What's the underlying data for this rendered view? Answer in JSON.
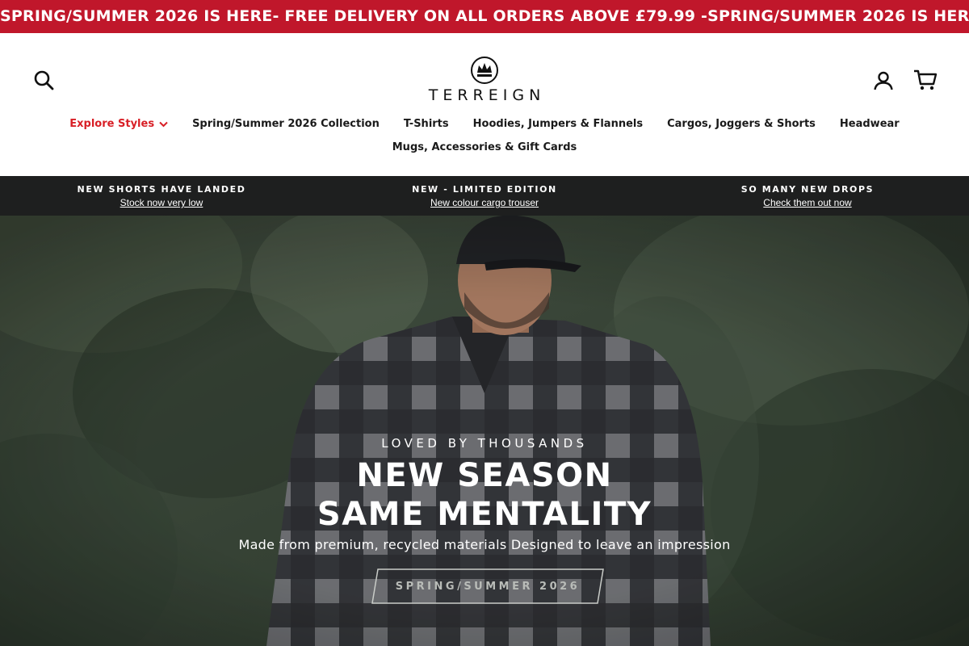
{
  "announcement": {
    "text": "SPRING/SUMMER 2026 IS HERE- FREE DELIVERY ON ALL ORDERS ABOVE £79.99 - ",
    "text_repeat": "SPRING/SUMMER 2026 IS HERE- FREE DELIVERY ON ALL ORDERS ABOVE £79.99 - ",
    "background": "#c0172b"
  },
  "header": {
    "logo_text": "TERREIGN",
    "icons": {
      "search": "search-icon",
      "account": "account-icon",
      "cart": "cart-icon"
    }
  },
  "nav": {
    "row1": [
      {
        "label": "Explore Styles",
        "highlight": true
      },
      {
        "label": "Spring/Summer 2026 Collection"
      },
      {
        "label": "T-Shirts"
      },
      {
        "label": "Hoodies, Jumpers & Flannels"
      },
      {
        "label": "Cargos, Joggers & Shorts"
      },
      {
        "label": "Headwear"
      }
    ],
    "row2": [
      {
        "label": "Mugs, Accessories & Gift Cards"
      }
    ],
    "highlight_color": "#d81f26"
  },
  "promos": [
    {
      "title": "NEW SHORTS HAVE LANDED",
      "link": "Stock now very low"
    },
    {
      "title": "NEW - LIMITED EDITION",
      "link": "New colour cargo trouser"
    },
    {
      "title": "SO MANY NEW DROPS",
      "link": "Check them out now"
    }
  ],
  "hero": {
    "eyebrow": "LOVED BY THOUSANDS",
    "headline_line1": "NEW SEASON",
    "headline_line2": "SAME MENTALITY",
    "subline": "Made from premium, recycled materials Designed to leave an impression",
    "cta_label": "SPRING/SUMMER 2026"
  }
}
